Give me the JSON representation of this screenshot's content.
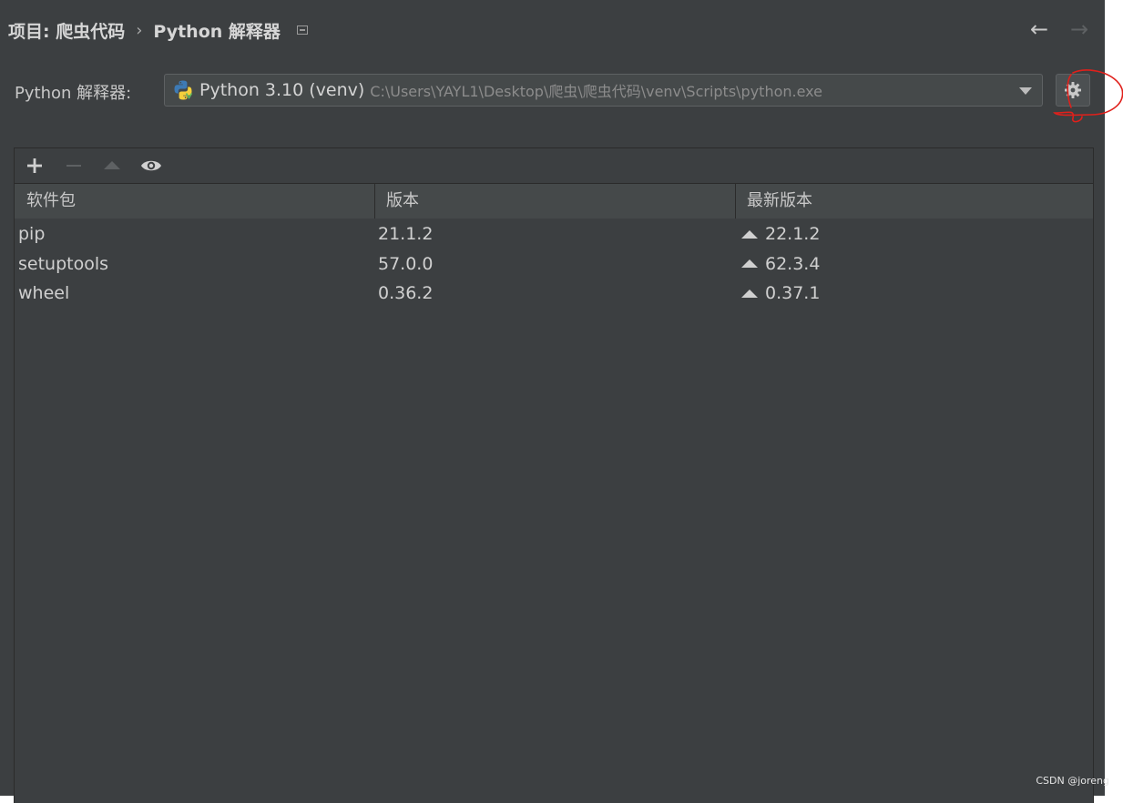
{
  "header": {
    "breadcrumb_project": "项目: 爬虫代码",
    "breadcrumb_separator": "›",
    "breadcrumb_page": "Python 解释器",
    "back_icon": "left-arrow-icon",
    "forward_icon": "right-arrow-icon"
  },
  "interpreter": {
    "label": "Python 解释器:",
    "selected_name": "Python 3.10 (venv)",
    "selected_path": "C:\\Users\\YAYL1\\Desktop\\爬虫\\爬虫代码\\venv\\Scripts\\python.exe",
    "settings_icon": "gear-icon",
    "annotation_color": "#e0201b"
  },
  "toolbar": {
    "add_icon": "plus-icon",
    "remove_icon": "minus-icon",
    "upgrade_icon": "upgrade-triangle-icon",
    "show_early_releases_icon": "eye-icon"
  },
  "table": {
    "columns": [
      "软件包",
      "版本",
      "最新版本"
    ],
    "rows": [
      {
        "package": "pip",
        "version": "21.1.2",
        "latest": "22.1.2"
      },
      {
        "package": "setuptools",
        "version": "57.0.0",
        "latest": "62.3.4"
      },
      {
        "package": "wheel",
        "version": "0.36.2",
        "latest": "0.37.1"
      }
    ]
  },
  "watermark": "CSDN @joreng",
  "colors": {
    "background": "#3c3f41",
    "header_row": "#45494a",
    "text": "#d0d0d0"
  }
}
